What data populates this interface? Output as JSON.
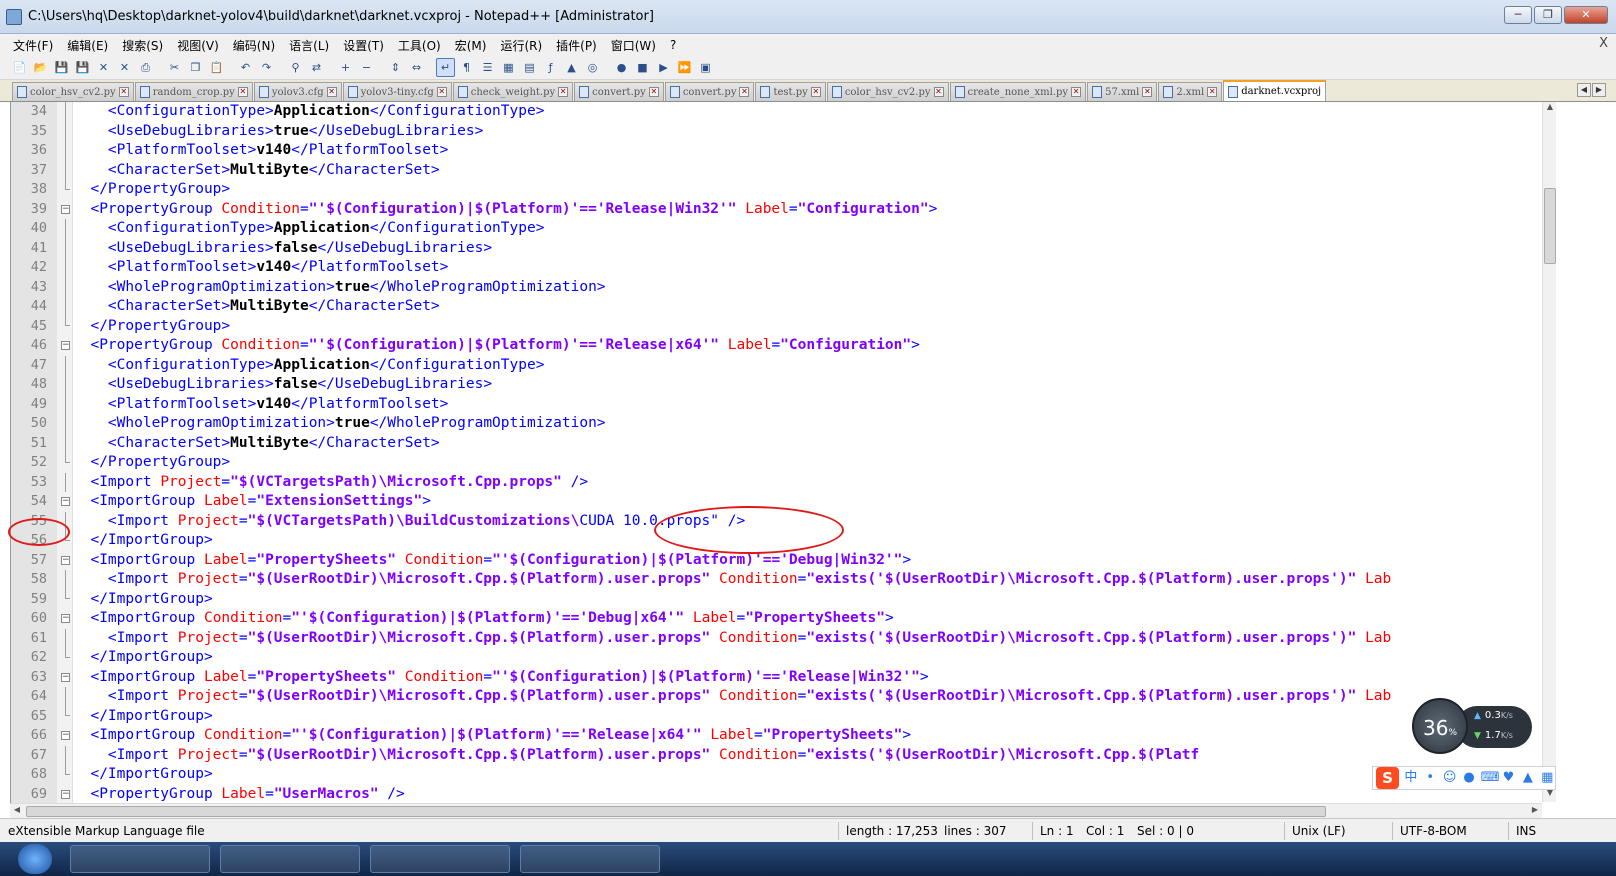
{
  "window": {
    "title": "C:\\Users\\hq\\Desktop\\darknet-yolov4\\build\\darknet\\darknet.vcxproj - Notepad++ [Administrator]",
    "minimize_icon": "minimize-icon",
    "maximize_icon": "restore-icon",
    "close_icon": "close-icon"
  },
  "menu": [
    "文件(F)",
    "编辑(E)",
    "搜索(S)",
    "视图(V)",
    "编码(N)",
    "语言(L)",
    "设置(T)",
    "工具(O)",
    "宏(M)",
    "运行(R)",
    "插件(P)",
    "窗口(W)",
    "?"
  ],
  "menu_close": "X",
  "toolbar": [
    "new-icon",
    "open-icon",
    "save-icon",
    "save-all-icon",
    "close-icon",
    "close-all-icon",
    "print-icon",
    "cut-icon",
    "copy-icon",
    "paste-icon",
    "undo-icon",
    "redo-icon",
    "find-icon",
    "replace-icon",
    "zoom-in-icon",
    "zoom-out-icon",
    "sync-vertical-icon",
    "sync-horizontal-icon",
    "word-wrap-icon",
    "show-all-chars-icon",
    "indent-guide-icon",
    "udl-icon",
    "doc-map-icon",
    "function-list-icon",
    "folder-workspace-icon",
    "monitoring-icon",
    "record-macro-icon",
    "stop-macro-icon",
    "play-macro-icon",
    "run-macro-multiple-icon",
    "save-macro-icon"
  ],
  "tabs": [
    {
      "label": "color_hsv_cv2.py",
      "active": false
    },
    {
      "label": "random_crop.py",
      "active": false
    },
    {
      "label": "yolov3.cfg",
      "active": false
    },
    {
      "label": "yolov3-tiny.cfg",
      "active": false
    },
    {
      "label": "check_weight.py",
      "active": false
    },
    {
      "label": "convert.py",
      "active": false
    },
    {
      "label": "convert.py",
      "active": false
    },
    {
      "label": "test.py",
      "active": false
    },
    {
      "label": "color_hsv_cv2.py",
      "active": false
    },
    {
      "label": "create_none_xml.py",
      "active": false
    },
    {
      "label": "57.xml",
      "active": false
    },
    {
      "label": "2.xml",
      "active": false
    },
    {
      "label": "darknet.vcxproj",
      "active": true
    }
  ],
  "editor": {
    "lines": [
      {
        "n": "34",
        "fold": "line",
        "parts": [
          [
            "i",
            "    "
          ],
          [
            "tag",
            "<ConfigurationType>"
          ],
          [
            "txt",
            "Application"
          ],
          [
            "tag",
            "</ConfigurationType>"
          ]
        ]
      },
      {
        "n": "35",
        "fold": "line",
        "parts": [
          [
            "i",
            "    "
          ],
          [
            "tag",
            "<UseDebugLibraries>"
          ],
          [
            "txt",
            "true"
          ],
          [
            "tag",
            "</UseDebugLibraries>"
          ]
        ]
      },
      {
        "n": "36",
        "fold": "line",
        "parts": [
          [
            "i",
            "    "
          ],
          [
            "tag",
            "<PlatformToolset>"
          ],
          [
            "txt",
            "v140"
          ],
          [
            "tag",
            "</PlatformToolset>"
          ]
        ]
      },
      {
        "n": "37",
        "fold": "line",
        "parts": [
          [
            "i",
            "    "
          ],
          [
            "tag",
            "<CharacterSet>"
          ],
          [
            "txt",
            "MultiByte"
          ],
          [
            "tag",
            "</CharacterSet>"
          ]
        ]
      },
      {
        "n": "38",
        "fold": "end",
        "parts": [
          [
            "i",
            "  "
          ],
          [
            "tag",
            "</PropertyGroup>"
          ]
        ]
      },
      {
        "n": "39",
        "fold": "start",
        "parts": [
          [
            "i",
            "  "
          ],
          [
            "tag",
            "<PropertyGroup "
          ],
          [
            "attr",
            "Condition"
          ],
          [
            "tag",
            "="
          ],
          [
            "val",
            "\"'$(Configuration)|$(Platform)'=='Release|Win32'\""
          ],
          [
            "tag",
            " "
          ],
          [
            "attr",
            "Label"
          ],
          [
            "tag",
            "="
          ],
          [
            "val",
            "\"Configuration\""
          ],
          [
            "tag",
            ">"
          ]
        ]
      },
      {
        "n": "40",
        "fold": "line",
        "parts": [
          [
            "i",
            "    "
          ],
          [
            "tag",
            "<ConfigurationType>"
          ],
          [
            "txt",
            "Application"
          ],
          [
            "tag",
            "</ConfigurationType>"
          ]
        ]
      },
      {
        "n": "41",
        "fold": "line",
        "parts": [
          [
            "i",
            "    "
          ],
          [
            "tag",
            "<UseDebugLibraries>"
          ],
          [
            "txt",
            "false"
          ],
          [
            "tag",
            "</UseDebugLibraries>"
          ]
        ]
      },
      {
        "n": "42",
        "fold": "line",
        "parts": [
          [
            "i",
            "    "
          ],
          [
            "tag",
            "<PlatformToolset>"
          ],
          [
            "txt",
            "v140"
          ],
          [
            "tag",
            "</PlatformToolset>"
          ]
        ]
      },
      {
        "n": "43",
        "fold": "line",
        "parts": [
          [
            "i",
            "    "
          ],
          [
            "tag",
            "<WholeProgramOptimization>"
          ],
          [
            "txt",
            "true"
          ],
          [
            "tag",
            "</WholeProgramOptimization>"
          ]
        ]
      },
      {
        "n": "44",
        "fold": "line",
        "parts": [
          [
            "i",
            "    "
          ],
          [
            "tag",
            "<CharacterSet>"
          ],
          [
            "txt",
            "MultiByte"
          ],
          [
            "tag",
            "</CharacterSet>"
          ]
        ]
      },
      {
        "n": "45",
        "fold": "end",
        "parts": [
          [
            "i",
            "  "
          ],
          [
            "tag",
            "</PropertyGroup>"
          ]
        ]
      },
      {
        "n": "46",
        "fold": "start",
        "parts": [
          [
            "i",
            "  "
          ],
          [
            "tag",
            "<PropertyGroup "
          ],
          [
            "attr",
            "Condition"
          ],
          [
            "tag",
            "="
          ],
          [
            "val",
            "\"'$(Configuration)|$(Platform)'=='Release|x64'\""
          ],
          [
            "tag",
            " "
          ],
          [
            "attr",
            "Label"
          ],
          [
            "tag",
            "="
          ],
          [
            "val",
            "\"Configuration\""
          ],
          [
            "tag",
            ">"
          ]
        ]
      },
      {
        "n": "47",
        "fold": "line",
        "parts": [
          [
            "i",
            "    "
          ],
          [
            "tag",
            "<ConfigurationType>"
          ],
          [
            "txt",
            "Application"
          ],
          [
            "tag",
            "</ConfigurationType>"
          ]
        ]
      },
      {
        "n": "48",
        "fold": "line",
        "parts": [
          [
            "i",
            "    "
          ],
          [
            "tag",
            "<UseDebugLibraries>"
          ],
          [
            "txt",
            "false"
          ],
          [
            "tag",
            "</UseDebugLibraries>"
          ]
        ]
      },
      {
        "n": "49",
        "fold": "line",
        "parts": [
          [
            "i",
            "    "
          ],
          [
            "tag",
            "<PlatformToolset>"
          ],
          [
            "txt",
            "v140"
          ],
          [
            "tag",
            "</PlatformToolset>"
          ]
        ]
      },
      {
        "n": "50",
        "fold": "line",
        "parts": [
          [
            "i",
            "    "
          ],
          [
            "tag",
            "<WholeProgramOptimization>"
          ],
          [
            "txt",
            "true"
          ],
          [
            "tag",
            "</WholeProgramOptimization>"
          ]
        ]
      },
      {
        "n": "51",
        "fold": "line",
        "parts": [
          [
            "i",
            "    "
          ],
          [
            "tag",
            "<CharacterSet>"
          ],
          [
            "txt",
            "MultiByte"
          ],
          [
            "tag",
            "</CharacterSet>"
          ]
        ]
      },
      {
        "n": "52",
        "fold": "end",
        "parts": [
          [
            "i",
            "  "
          ],
          [
            "tag",
            "</PropertyGroup>"
          ]
        ]
      },
      {
        "n": "53",
        "fold": "line",
        "parts": [
          [
            "i",
            "  "
          ],
          [
            "tag",
            "<Import "
          ],
          [
            "attr",
            "Project"
          ],
          [
            "tag",
            "="
          ],
          [
            "val",
            "\"$(VCTargetsPath)\\Microsoft.Cpp.props\""
          ],
          [
            "tag",
            " />"
          ]
        ]
      },
      {
        "n": "54",
        "fold": "start",
        "parts": [
          [
            "i",
            "  "
          ],
          [
            "tag",
            "<ImportGroup "
          ],
          [
            "attr",
            "Label"
          ],
          [
            "tag",
            "="
          ],
          [
            "val",
            "\"ExtensionSettings\""
          ],
          [
            "tag",
            ">"
          ]
        ]
      },
      {
        "n": "55",
        "fold": "line",
        "parts": [
          [
            "i",
            "    "
          ],
          [
            "tag",
            "<Import "
          ],
          [
            "attr",
            "Project"
          ],
          [
            "tag",
            "="
          ],
          [
            "val",
            "\"$(VCTargetsPath)\\BuildCustomizations\\"
          ],
          [
            "tag",
            "CUDA 10.0.props\" />"
          ]
        ]
      },
      {
        "n": "56",
        "fold": "end",
        "parts": [
          [
            "i",
            "  "
          ],
          [
            "tag",
            "</ImportGroup>"
          ]
        ]
      },
      {
        "n": "57",
        "fold": "start",
        "parts": [
          [
            "i",
            "  "
          ],
          [
            "tag",
            "<ImportGroup "
          ],
          [
            "attr",
            "Label"
          ],
          [
            "tag",
            "="
          ],
          [
            "val",
            "\"PropertySheets\""
          ],
          [
            "tag",
            " "
          ],
          [
            "attr",
            "Condition"
          ],
          [
            "tag",
            "="
          ],
          [
            "val",
            "\"'$(Configuration)|$(Platform)'=='Debug|Win32'\""
          ],
          [
            "tag",
            ">"
          ]
        ]
      },
      {
        "n": "58",
        "fold": "line",
        "parts": [
          [
            "i",
            "    "
          ],
          [
            "tag",
            "<Import "
          ],
          [
            "attr",
            "Project"
          ],
          [
            "tag",
            "="
          ],
          [
            "val",
            "\"$(UserRootDir)\\Microsoft.Cpp.$(Platform).user.props\""
          ],
          [
            "tag",
            " "
          ],
          [
            "attr",
            "Condition"
          ],
          [
            "tag",
            "="
          ],
          [
            "val",
            "\"exists('$(UserRootDir)\\Microsoft.Cpp.$(Platform).user.props')\""
          ],
          [
            "tag",
            " "
          ],
          [
            "attr",
            "Lab"
          ]
        ]
      },
      {
        "n": "59",
        "fold": "end",
        "parts": [
          [
            "i",
            "  "
          ],
          [
            "tag",
            "</ImportGroup>"
          ]
        ]
      },
      {
        "n": "60",
        "fold": "start",
        "parts": [
          [
            "i",
            "  "
          ],
          [
            "tag",
            "<ImportGroup "
          ],
          [
            "attr",
            "Condition"
          ],
          [
            "tag",
            "="
          ],
          [
            "val",
            "\"'$(Configuration)|$(Platform)'=='Debug|x64'\""
          ],
          [
            "tag",
            " "
          ],
          [
            "attr",
            "Label"
          ],
          [
            "tag",
            "="
          ],
          [
            "val",
            "\"PropertySheets\""
          ],
          [
            "tag",
            ">"
          ]
        ]
      },
      {
        "n": "61",
        "fold": "line",
        "parts": [
          [
            "i",
            "    "
          ],
          [
            "tag",
            "<Import "
          ],
          [
            "attr",
            "Project"
          ],
          [
            "tag",
            "="
          ],
          [
            "val",
            "\"$(UserRootDir)\\Microsoft.Cpp.$(Platform).user.props\""
          ],
          [
            "tag",
            " "
          ],
          [
            "attr",
            "Condition"
          ],
          [
            "tag",
            "="
          ],
          [
            "val",
            "\"exists('$(UserRootDir)\\Microsoft.Cpp.$(Platform).user.props')\""
          ],
          [
            "tag",
            " "
          ],
          [
            "attr",
            "Lab"
          ]
        ]
      },
      {
        "n": "62",
        "fold": "end",
        "parts": [
          [
            "i",
            "  "
          ],
          [
            "tag",
            "</ImportGroup>"
          ]
        ]
      },
      {
        "n": "63",
        "fold": "start",
        "parts": [
          [
            "i",
            "  "
          ],
          [
            "tag",
            "<ImportGroup "
          ],
          [
            "attr",
            "Label"
          ],
          [
            "tag",
            "="
          ],
          [
            "val",
            "\"PropertySheets\""
          ],
          [
            "tag",
            " "
          ],
          [
            "attr",
            "Condition"
          ],
          [
            "tag",
            "="
          ],
          [
            "val",
            "\"'$(Configuration)|$(Platform)'=='Release|Win32'\""
          ],
          [
            "tag",
            ">"
          ]
        ]
      },
      {
        "n": "64",
        "fold": "line",
        "parts": [
          [
            "i",
            "    "
          ],
          [
            "tag",
            "<Import "
          ],
          [
            "attr",
            "Project"
          ],
          [
            "tag",
            "="
          ],
          [
            "val",
            "\"$(UserRootDir)\\Microsoft.Cpp.$(Platform).user.props\""
          ],
          [
            "tag",
            " "
          ],
          [
            "attr",
            "Condition"
          ],
          [
            "tag",
            "="
          ],
          [
            "val",
            "\"exists('$(UserRootDir)\\Microsoft.Cpp.$(Platform).user.props')\""
          ],
          [
            "tag",
            " "
          ],
          [
            "attr",
            "Lab"
          ]
        ]
      },
      {
        "n": "65",
        "fold": "end",
        "parts": [
          [
            "i",
            "  "
          ],
          [
            "tag",
            "</ImportGroup>"
          ]
        ]
      },
      {
        "n": "66",
        "fold": "start",
        "parts": [
          [
            "i",
            "  "
          ],
          [
            "tag",
            "<ImportGroup "
          ],
          [
            "attr",
            "Condition"
          ],
          [
            "tag",
            "="
          ],
          [
            "val",
            "\"'$(Configuration)|$(Platform)'=='Release|x64'\""
          ],
          [
            "tag",
            " "
          ],
          [
            "attr",
            "Label"
          ],
          [
            "tag",
            "="
          ],
          [
            "val",
            "\"PropertySheets\""
          ],
          [
            "tag",
            ">"
          ]
        ]
      },
      {
        "n": "67",
        "fold": "line",
        "parts": [
          [
            "i",
            "    "
          ],
          [
            "tag",
            "<Import "
          ],
          [
            "attr",
            "Project"
          ],
          [
            "tag",
            "="
          ],
          [
            "val",
            "\"$(UserRootDir)\\Microsoft.Cpp.$(Platform).user.props\""
          ],
          [
            "tag",
            " "
          ],
          [
            "attr",
            "Condition"
          ],
          [
            "tag",
            "="
          ],
          [
            "val",
            "\"exists('$(UserRootDir)\\Microsoft.Cpp.$(Platf"
          ]
        ]
      },
      {
        "n": "68",
        "fold": "end",
        "parts": [
          [
            "i",
            "  "
          ],
          [
            "tag",
            "</ImportGroup>"
          ]
        ]
      },
      {
        "n": "69",
        "fold": "start",
        "parts": [
          [
            "i",
            "  "
          ],
          [
            "tag",
            "<PropertyGroup "
          ],
          [
            "attr",
            "Label"
          ],
          [
            "tag",
            "="
          ],
          [
            "val",
            "\"UserMacros\""
          ],
          [
            "tag",
            " />"
          ]
        ]
      }
    ]
  },
  "status": {
    "file_type": "eXtensible Markup Language file",
    "length": "length : 17,253",
    "lines": "lines : 307",
    "ln": "Ln : 1",
    "col": "Col : 1",
    "sel": "Sel : 0 | 0",
    "eol": "Unix (LF)",
    "encoding": "UTF-8-BOM",
    "mode": "INS"
  },
  "net_widget": {
    "cpu_percent": "36",
    "percent_sign": "%",
    "up_speed": "0.3",
    "down_speed": "1.7",
    "unit": "K/s"
  },
  "ime": {
    "logo": "S",
    "lang": "中",
    "icons": [
      "punctuation-icon",
      "emoji-icon",
      "voice-icon",
      "keyboard-icon",
      "skin-icon",
      "toolbox-icon",
      "grid-icon"
    ]
  },
  "colors": {
    "tag": "#0000ff",
    "attribute": "#ff0000",
    "value": "#8000ff",
    "annotation": "#e01818"
  }
}
